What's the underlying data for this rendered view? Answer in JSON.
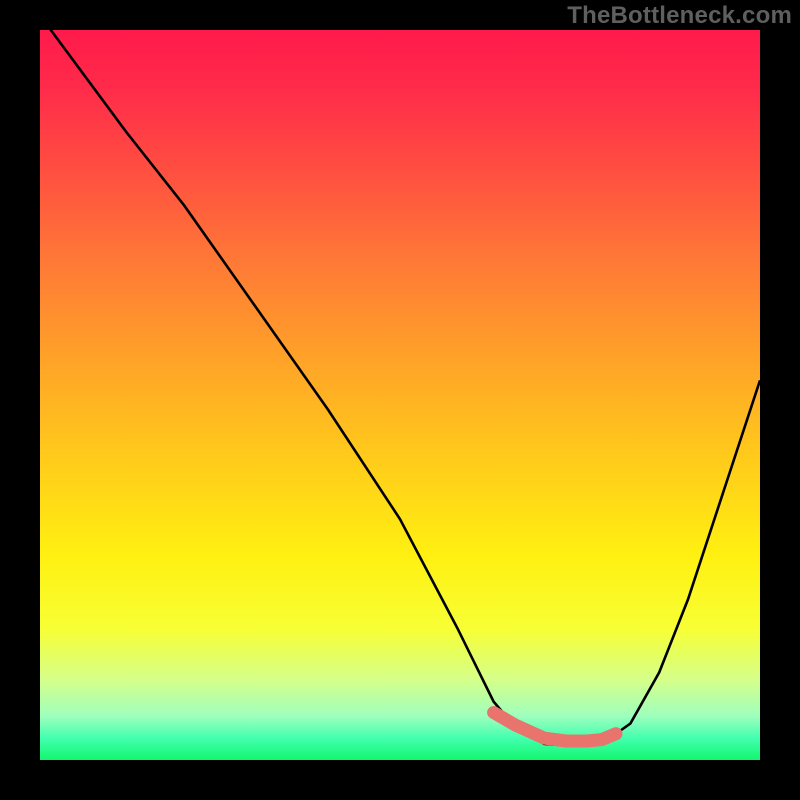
{
  "watermark": "TheBottleneck.com",
  "chart_data": {
    "type": "line",
    "title": "",
    "xlabel": "",
    "ylabel": "",
    "xlim": [
      0,
      100
    ],
    "ylim": [
      0,
      100
    ],
    "series": [
      {
        "name": "curve",
        "x": [
          0,
          6,
          12,
          20,
          30,
          40,
          50,
          58,
          60,
          63,
          66,
          70,
          73,
          75,
          78,
          82,
          86,
          90,
          94,
          100
        ],
        "values": [
          102,
          94,
          86,
          76,
          62,
          48,
          33,
          18,
          14,
          8,
          4.5,
          2.2,
          2.0,
          2.0,
          2.2,
          5,
          12,
          22,
          34,
          52
        ]
      },
      {
        "name": "min-marker",
        "x": [
          63,
          66,
          70,
          73,
          76,
          78,
          80
        ],
        "values": [
          6.5,
          4.8,
          3.0,
          2.6,
          2.6,
          2.8,
          3.6
        ]
      }
    ]
  },
  "colors": {
    "curve": "#000000",
    "marker": "#e8746d",
    "gradient_top": "#ff1a4b",
    "gradient_bottom": "#11f76e"
  }
}
